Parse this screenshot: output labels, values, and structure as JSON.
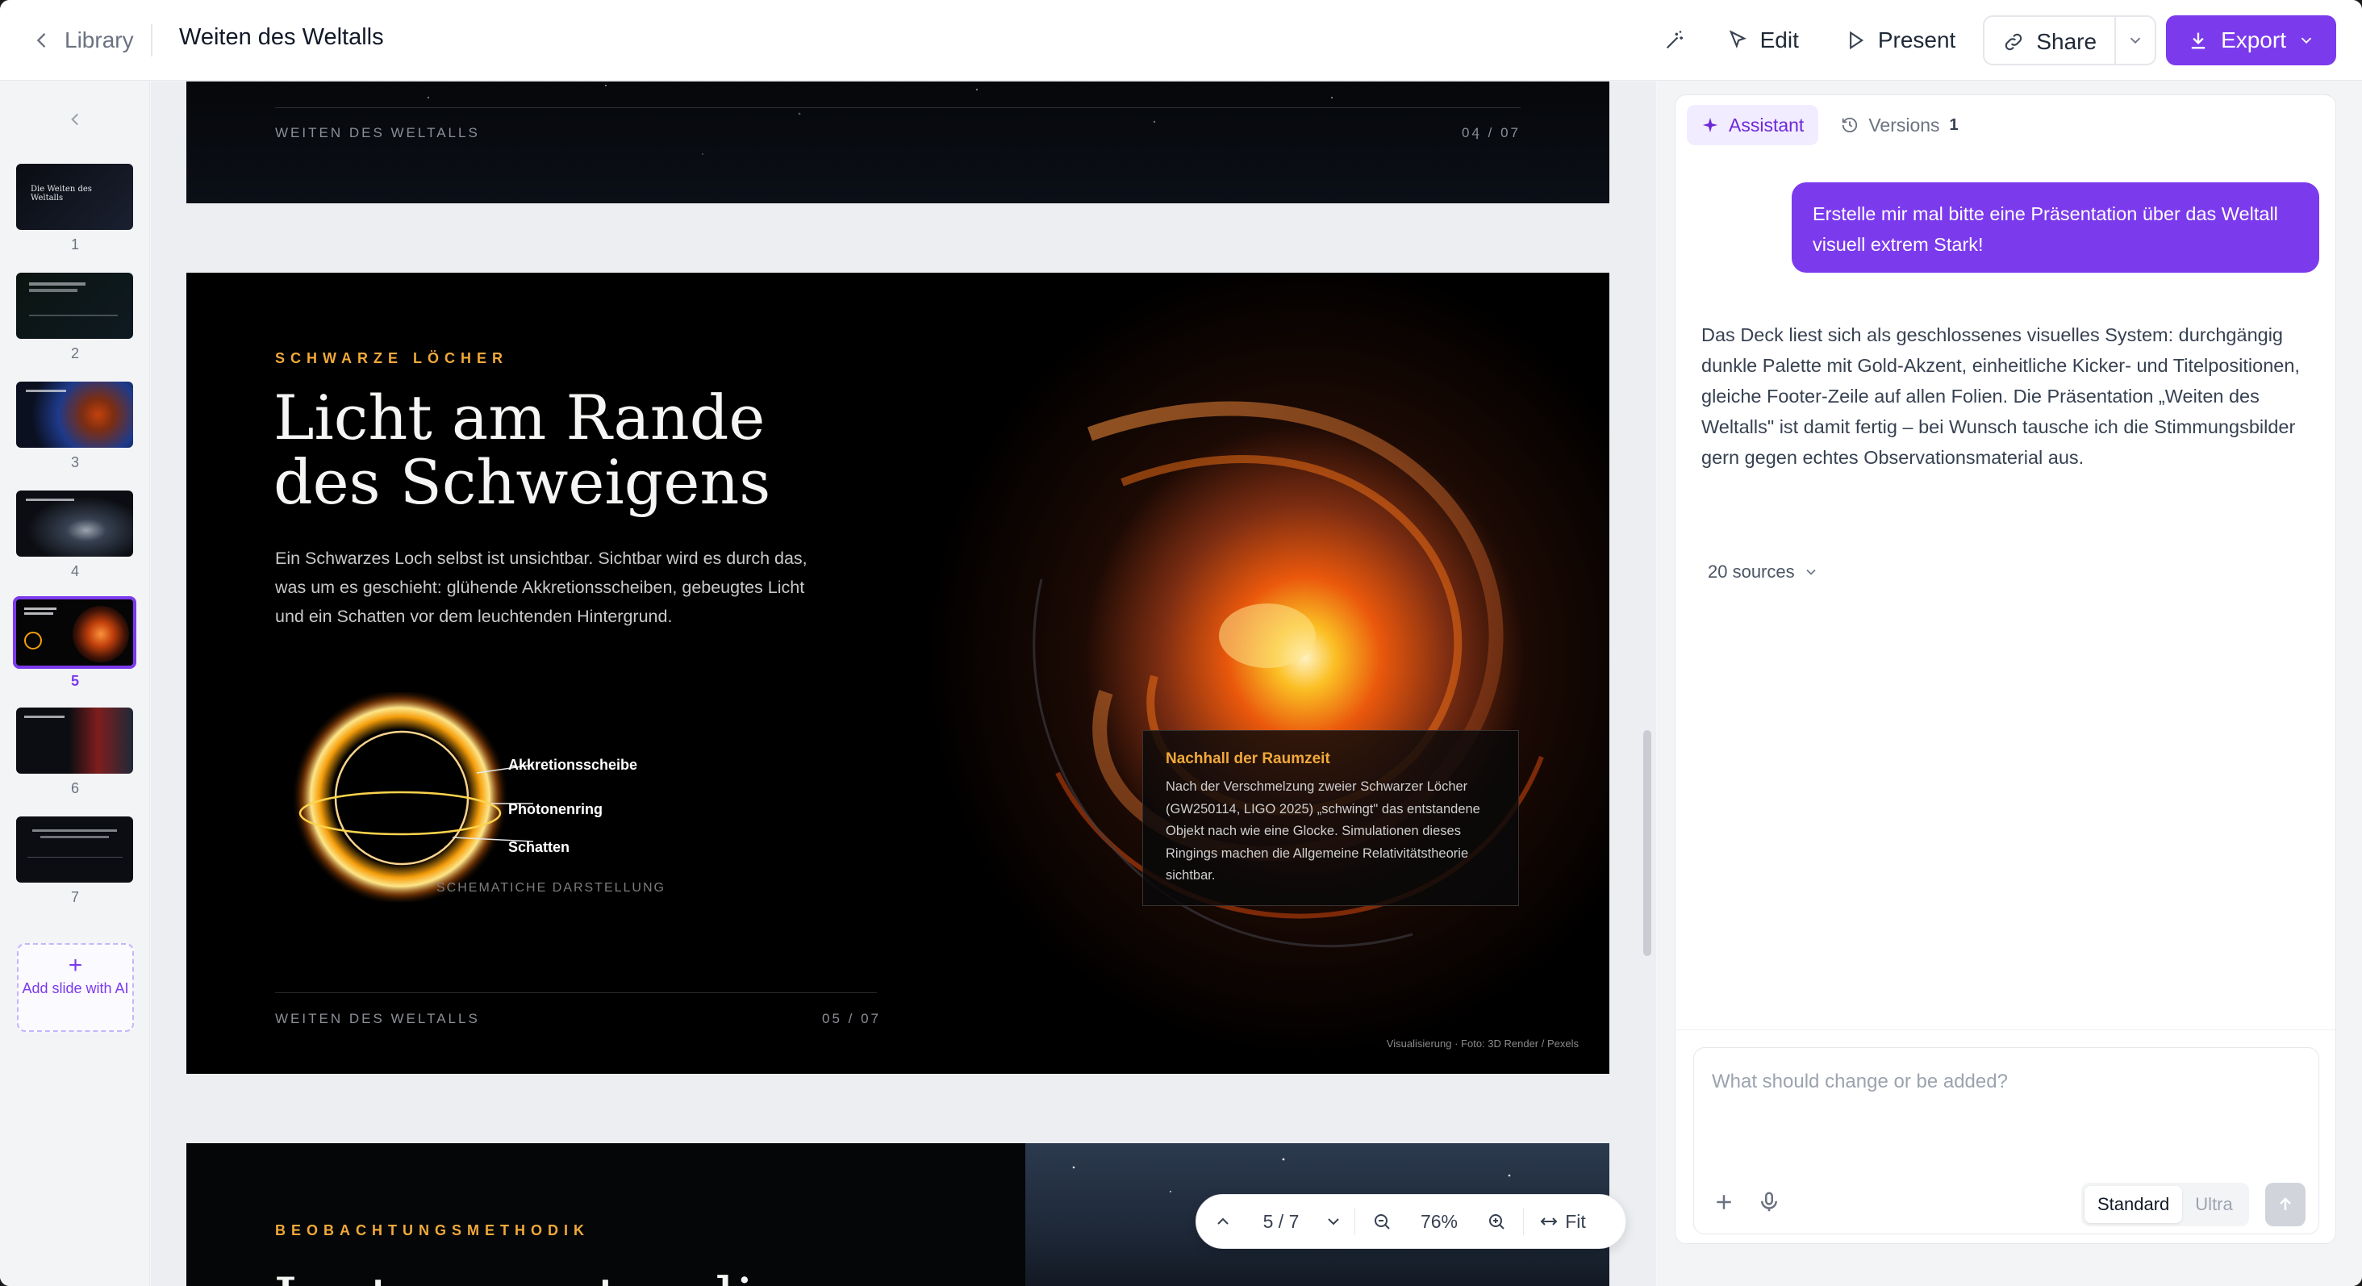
{
  "topbar": {
    "back_label": "Library",
    "doc_title": "Weiten des Weltalls",
    "edit_label": "Edit",
    "present_label": "Present",
    "share_label": "Share",
    "export_label": "Export"
  },
  "thumbnails": {
    "items": [
      {
        "number": "1",
        "title": "Die Weiten des Weltalls"
      },
      {
        "number": "2",
        "title": ""
      },
      {
        "number": "3",
        "title": ""
      },
      {
        "number": "4",
        "title": ""
      },
      {
        "number": "5",
        "title": ""
      },
      {
        "number": "6",
        "title": ""
      },
      {
        "number": "7",
        "title": ""
      }
    ],
    "active_index": 5,
    "add_slide_label": "Add slide with AI"
  },
  "slide4": {
    "footer_left": "WEITEN DES WELTALLS",
    "footer_right": "04 / 07"
  },
  "slide5": {
    "kicker": "SCHWARZE LÖCHER",
    "title_line1": "Licht am Rande",
    "title_line2": "des Schweigens",
    "body": "Ein Schwarzes Loch selbst ist unsichtbar. Sichtbar wird es durch das, was um es geschieht: glühende Akkretionsscheiben, gebeugtes Licht und ein Schatten vor dem leuchtenden Hintergrund.",
    "diagram_labels": {
      "disk": "Akkretionsscheibe",
      "ring": "Photonenring",
      "shadow": "Schatten"
    },
    "diagram_caption": "SCHEMATICHE DARSTELLUNG",
    "callout_title": "Nachhall der Raumzeit",
    "callout_body": "Nach der Verschmelzung zweier Schwarzer Löcher (GW250114, LIGO 2025) „schwingt\" das entstandene Objekt nach wie eine Glocke. Simulationen dieses Ringings machen die Allgemeine Relativitätstheorie sichtbar.",
    "credit": "Visualisierung · Foto: 3D Render / Pexels",
    "footer_left": "WEITEN DES WELTALLS",
    "footer_right": "05 / 07"
  },
  "slide6": {
    "kicker": "BEOBACHTUNGSMETHODIK",
    "title_partial": "Instrumente, die"
  },
  "zoom": {
    "page_indicator": "5 / 7",
    "zoom_level": "76%",
    "fit_label": "Fit"
  },
  "panel": {
    "tab_assistant": "Assistant",
    "tab_versions": "Versions",
    "versions_count": "1",
    "user_message": "Erstelle mir mal bitte eine Präsentation über das Weltall visuell extrem Stark!",
    "assistant_message": "Das Deck liest sich als geschlossenes visuelles System: durchgängig dunkle Palette mit Gold-Akzent, einheitliche Kicker- und Titelpositionen, gleiche Footer-Zeile auf allen Folien. Die Präsentation „Weiten des Weltalls\" ist damit fertig – bei Wunsch tausche ich die Stimmungsbilder gern gegen echtes Observationsmaterial aus.",
    "sources_label": "20 sources",
    "composer_placeholder": "What should change or be added?",
    "mode_standard": "Standard",
    "mode_ultra": "Ultra"
  },
  "colors": {
    "accent": "#7c3aed",
    "slide_gold": "#f0a93a"
  }
}
